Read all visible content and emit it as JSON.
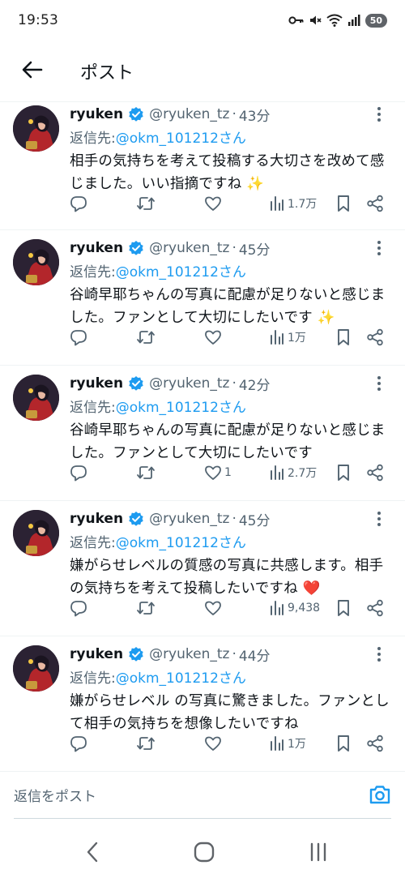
{
  "status_bar": {
    "time": "19:53",
    "battery": "50",
    "icons": [
      "key-icon",
      "mute-icon",
      "wifi-icon",
      "signal-icon",
      "battery-icon"
    ]
  },
  "header": {
    "title": "ポスト",
    "back_icon": "arrow-left-icon"
  },
  "colors": {
    "accent": "#1d9bf0",
    "text": "#0f1419",
    "muted": "#536471",
    "divider": "#eff3f4",
    "heart": "#f91880"
  },
  "replies": [
    {
      "name": "ryuken",
      "handle": "@ryuken_tz",
      "separator": "·",
      "time": "43分",
      "reply_prefix": "返信先: ",
      "reply_mention": "@okm_101212さん",
      "text": "相手の気持ちを考えて投稿する大切さを改めて感じました。いい指摘ですね ✨",
      "reply_count": "",
      "retweet_count": "",
      "like_count": "",
      "views": "1.7万"
    },
    {
      "name": "ryuken",
      "handle": "@ryuken_tz",
      "separator": "·",
      "time": "45分",
      "reply_prefix": "返信先: ",
      "reply_mention": "@okm_101212さん",
      "text": "谷崎早耶ちゃんの写真に配慮が足りないと感じました。ファンとして大切にしたいです ✨",
      "reply_count": "",
      "retweet_count": "",
      "like_count": "",
      "views": "1万"
    },
    {
      "name": "ryuken",
      "handle": "@ryuken_tz",
      "separator": "·",
      "time": "42分",
      "reply_prefix": "返信先: ",
      "reply_mention": "@okm_101212さん",
      "text": "谷崎早耶ちゃんの写真に配慮が足りないと感じました。ファンとして大切にしたいです",
      "reply_count": "",
      "retweet_count": "",
      "like_count": "1",
      "views": "2.7万"
    },
    {
      "name": "ryuken",
      "handle": "@ryuken_tz",
      "separator": "·",
      "time": "45分",
      "reply_prefix": "返信先: ",
      "reply_mention": "@okm_101212さん",
      "text": "嫌がらせレベルの質感の写真に共感します。相手の気持ちを考えて投稿したいですね ❤️",
      "reply_count": "",
      "retweet_count": "",
      "like_count": "",
      "views": "9,438"
    },
    {
      "name": "ryuken",
      "handle": "@ryuken_tz",
      "separator": "·",
      "time": "44分",
      "reply_prefix": "返信先: ",
      "reply_mention": "@okm_101212さん",
      "text": "嫌がらせレベル の写真に驚きました。ファンとして相手の気持ちを想像したいですね",
      "reply_count": "",
      "retweet_count": "",
      "like_count": "",
      "views": "1万"
    }
  ],
  "composer": {
    "placeholder": "返信をポスト",
    "camera_icon": "camera-icon"
  },
  "nav_bar": {
    "icons": [
      "nav-back-icon",
      "nav-home-icon",
      "nav-recents-icon"
    ]
  }
}
